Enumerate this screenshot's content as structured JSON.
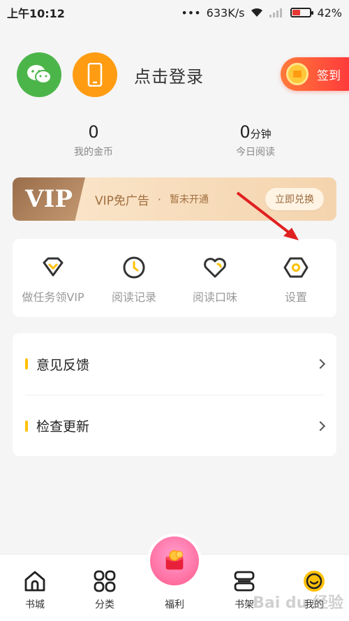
{
  "status": {
    "time": "上午10:12",
    "dots": "•••",
    "speed": "633K/s",
    "battery": "42%",
    "battery_level": 0.42
  },
  "header": {
    "login_text": "点击登录",
    "signin_label": "签到"
  },
  "stats": [
    {
      "value": "0",
      "unit": "",
      "label": "我的金币"
    },
    {
      "value": "0",
      "unit": "分钟",
      "label": "今日阅读"
    }
  ],
  "vip": {
    "logo": "VIP",
    "title": "VIP免广告",
    "dot": "·",
    "status": "暂未开通",
    "button": "立即兑换"
  },
  "shortcuts": [
    {
      "label": "做任务领VIP",
      "icon": "diamond-icon"
    },
    {
      "label": "阅读记录",
      "icon": "clock-icon"
    },
    {
      "label": "阅读口味",
      "icon": "heart-icon"
    },
    {
      "label": "设置",
      "icon": "settings-hexagon-icon"
    }
  ],
  "list": [
    {
      "label": "意见反馈"
    },
    {
      "label": "检查更新"
    }
  ],
  "nav": [
    {
      "label": "书城",
      "icon": "home-icon"
    },
    {
      "label": "分类",
      "icon": "category-icon"
    },
    {
      "label": "福利",
      "icon": "red-envelope-icon"
    },
    {
      "label": "书架",
      "icon": "bookshelf-icon"
    },
    {
      "label": "我的",
      "icon": "smile-icon"
    }
  ],
  "watermark": "Bai du 经验",
  "colors": {
    "accent": "#ffc107",
    "signin": "#ff3b3b",
    "wechat": "#4cb54a",
    "phone": "#ff9c12",
    "arrow": "#e02020"
  }
}
